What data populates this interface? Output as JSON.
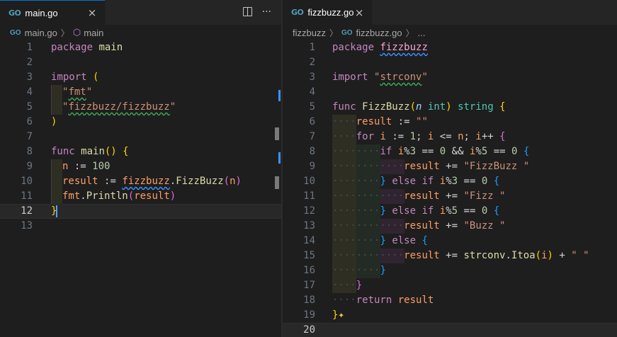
{
  "left": {
    "tab": {
      "icon": "go-icon",
      "label": "main.go",
      "close": "×"
    },
    "actions": {
      "split": "split-editor-icon",
      "more": "···"
    },
    "breadcrumb": {
      "file": "main.go",
      "symbol": "main"
    },
    "current_line": "12"
  },
  "right": {
    "tab": {
      "icon": "go-icon",
      "label": "fizzbuzz.go",
      "close": "×"
    },
    "breadcrumb": {
      "folder": "fizzbuzz",
      "file": "fizzbuzz.go",
      "more": "..."
    }
  },
  "glyphs": {
    "go": "GO",
    "sep": "〉",
    "cube": "⬡",
    "sparkle": "✦"
  },
  "colors": {
    "accent": "#0078d4",
    "background": "#1e1e1e",
    "tabbar": "#252526"
  }
}
